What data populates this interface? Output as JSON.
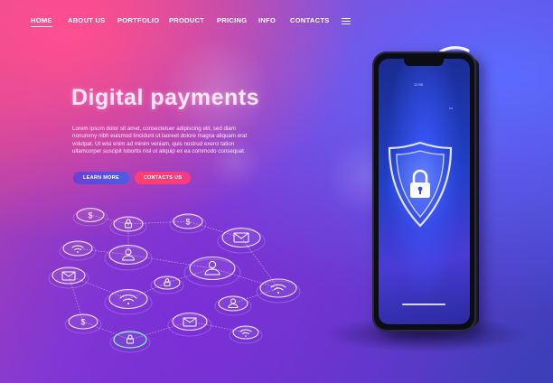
{
  "nav": {
    "items": [
      {
        "label": "HOME",
        "active": true
      },
      {
        "label": "ABOUT US",
        "active": false
      },
      {
        "label": "PORTFOLIO",
        "active": false
      },
      {
        "label": "PRODUCT",
        "active": false
      },
      {
        "label": "PRICING",
        "active": false
      },
      {
        "label": "INFO",
        "active": false
      },
      {
        "label": "CONTACTS",
        "active": false
      }
    ],
    "menu_icon": "hamburger-menu-icon"
  },
  "hero": {
    "title": "Digital payments",
    "body": "Lorem ipsum dolor sit amet, consectetuer adipiscing elit, sed diam nonummy nibh euismod tincidunt ut laoreet dolore magna aliquam erat volutpat. Ut wisi enim ad minim veniam, quis nostrud exerci tation ullamcorper suscipit lobortis nisl ut aliquip ex ea commodo consequat.",
    "learn_more_label": "LEARN MORE",
    "contact_label": "CONTACTS US"
  },
  "illustration": {
    "network_icons": [
      "dollar-icon",
      "mail-icon",
      "user-icon",
      "wifi-icon",
      "lock-icon"
    ],
    "phone_screen": {
      "time": "12:55",
      "status_indicator": "•••",
      "center_icon": "shield-lock-icon"
    },
    "signal_icon": "wireless-signal-icon"
  },
  "colors": {
    "accent_pink": "#f33c86",
    "accent_purple": "#5b4ee0",
    "nav_text": "#ffffff"
  }
}
